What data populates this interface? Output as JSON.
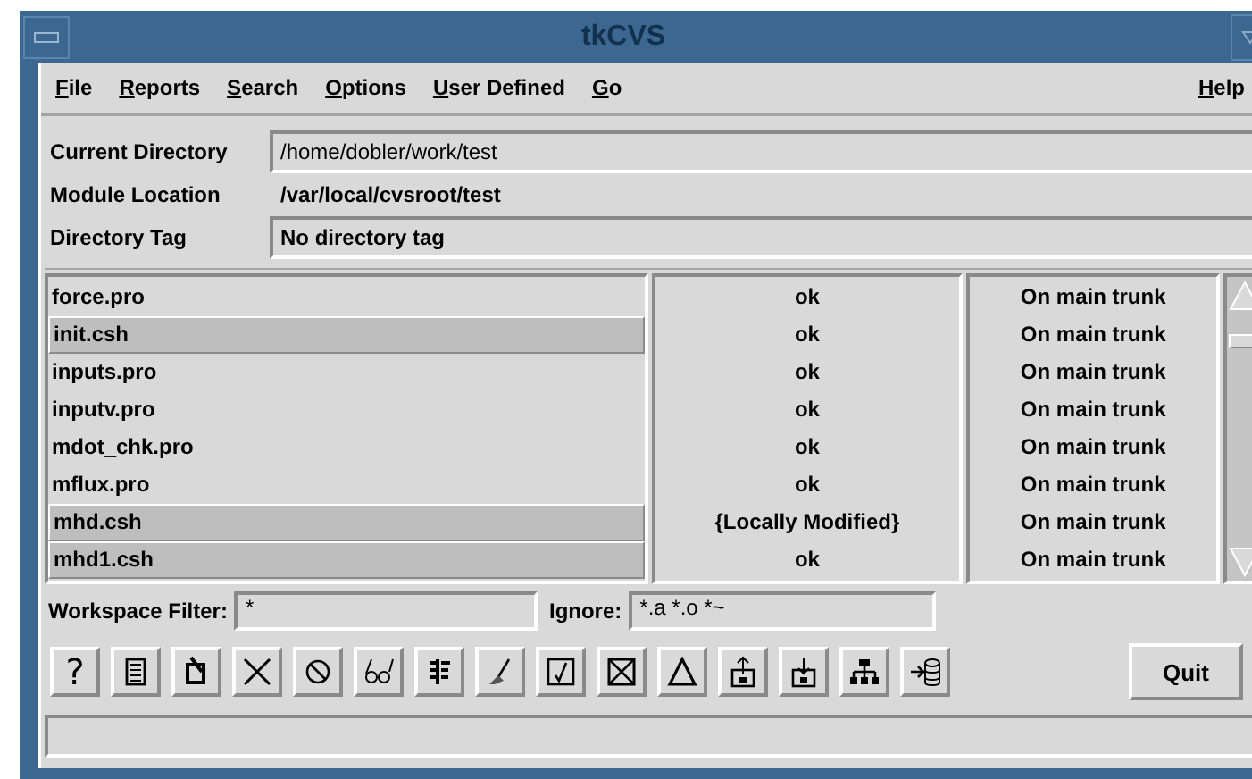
{
  "window": {
    "title": "tkCVS"
  },
  "menu": {
    "items": [
      {
        "label": "File"
      },
      {
        "label": "Reports"
      },
      {
        "label": "Search"
      },
      {
        "label": "Options"
      },
      {
        "label": "User Defined"
      },
      {
        "label": "Go"
      }
    ],
    "help": {
      "label": "Help"
    }
  },
  "info": {
    "current_directory": {
      "label": "Current Directory",
      "value": "/home/dobler/work/test"
    },
    "module_location": {
      "label": "Module Location",
      "value": "/var/local/cvsroot/test"
    },
    "directory_tag": {
      "label": "Directory Tag",
      "value": "No directory tag"
    }
  },
  "files": [
    {
      "name": "force.pro",
      "status": "ok",
      "tag": "On main trunk",
      "selected": false
    },
    {
      "name": "init.csh",
      "status": "ok",
      "tag": "On main trunk",
      "selected": true
    },
    {
      "name": "inputs.pro",
      "status": "ok",
      "tag": "On main trunk",
      "selected": false
    },
    {
      "name": "inputv.pro",
      "status": "ok",
      "tag": "On main trunk",
      "selected": false
    },
    {
      "name": "mdot_chk.pro",
      "status": "ok",
      "tag": "On main trunk",
      "selected": false
    },
    {
      "name": "mflux.pro",
      "status": "ok",
      "tag": "On main trunk",
      "selected": false
    },
    {
      "name": "mhd.csh",
      "status": "{Locally Modified}",
      "tag": "On main trunk",
      "selected": true
    },
    {
      "name": "mhd1.csh",
      "status": "ok",
      "tag": "On main trunk",
      "selected": true
    }
  ],
  "filter": {
    "label": "Workspace Filter:",
    "value": "*"
  },
  "ignore": {
    "label": "Ignore:",
    "value": "*.a *.o *~"
  },
  "toolbar": [
    {
      "kind": "text",
      "text": "?"
    },
    {
      "kind": "notes"
    },
    {
      "kind": "edit"
    },
    {
      "kind": "delete"
    },
    {
      "kind": "cancel"
    },
    {
      "kind": "glasses"
    },
    {
      "kind": "log"
    },
    {
      "kind": "broom"
    },
    {
      "kind": "check"
    },
    {
      "kind": "xbox"
    },
    {
      "kind": "delta"
    },
    {
      "kind": "upload"
    },
    {
      "kind": "download"
    },
    {
      "kind": "tree"
    },
    {
      "kind": "import"
    }
  ],
  "quit_button": "Quit"
}
